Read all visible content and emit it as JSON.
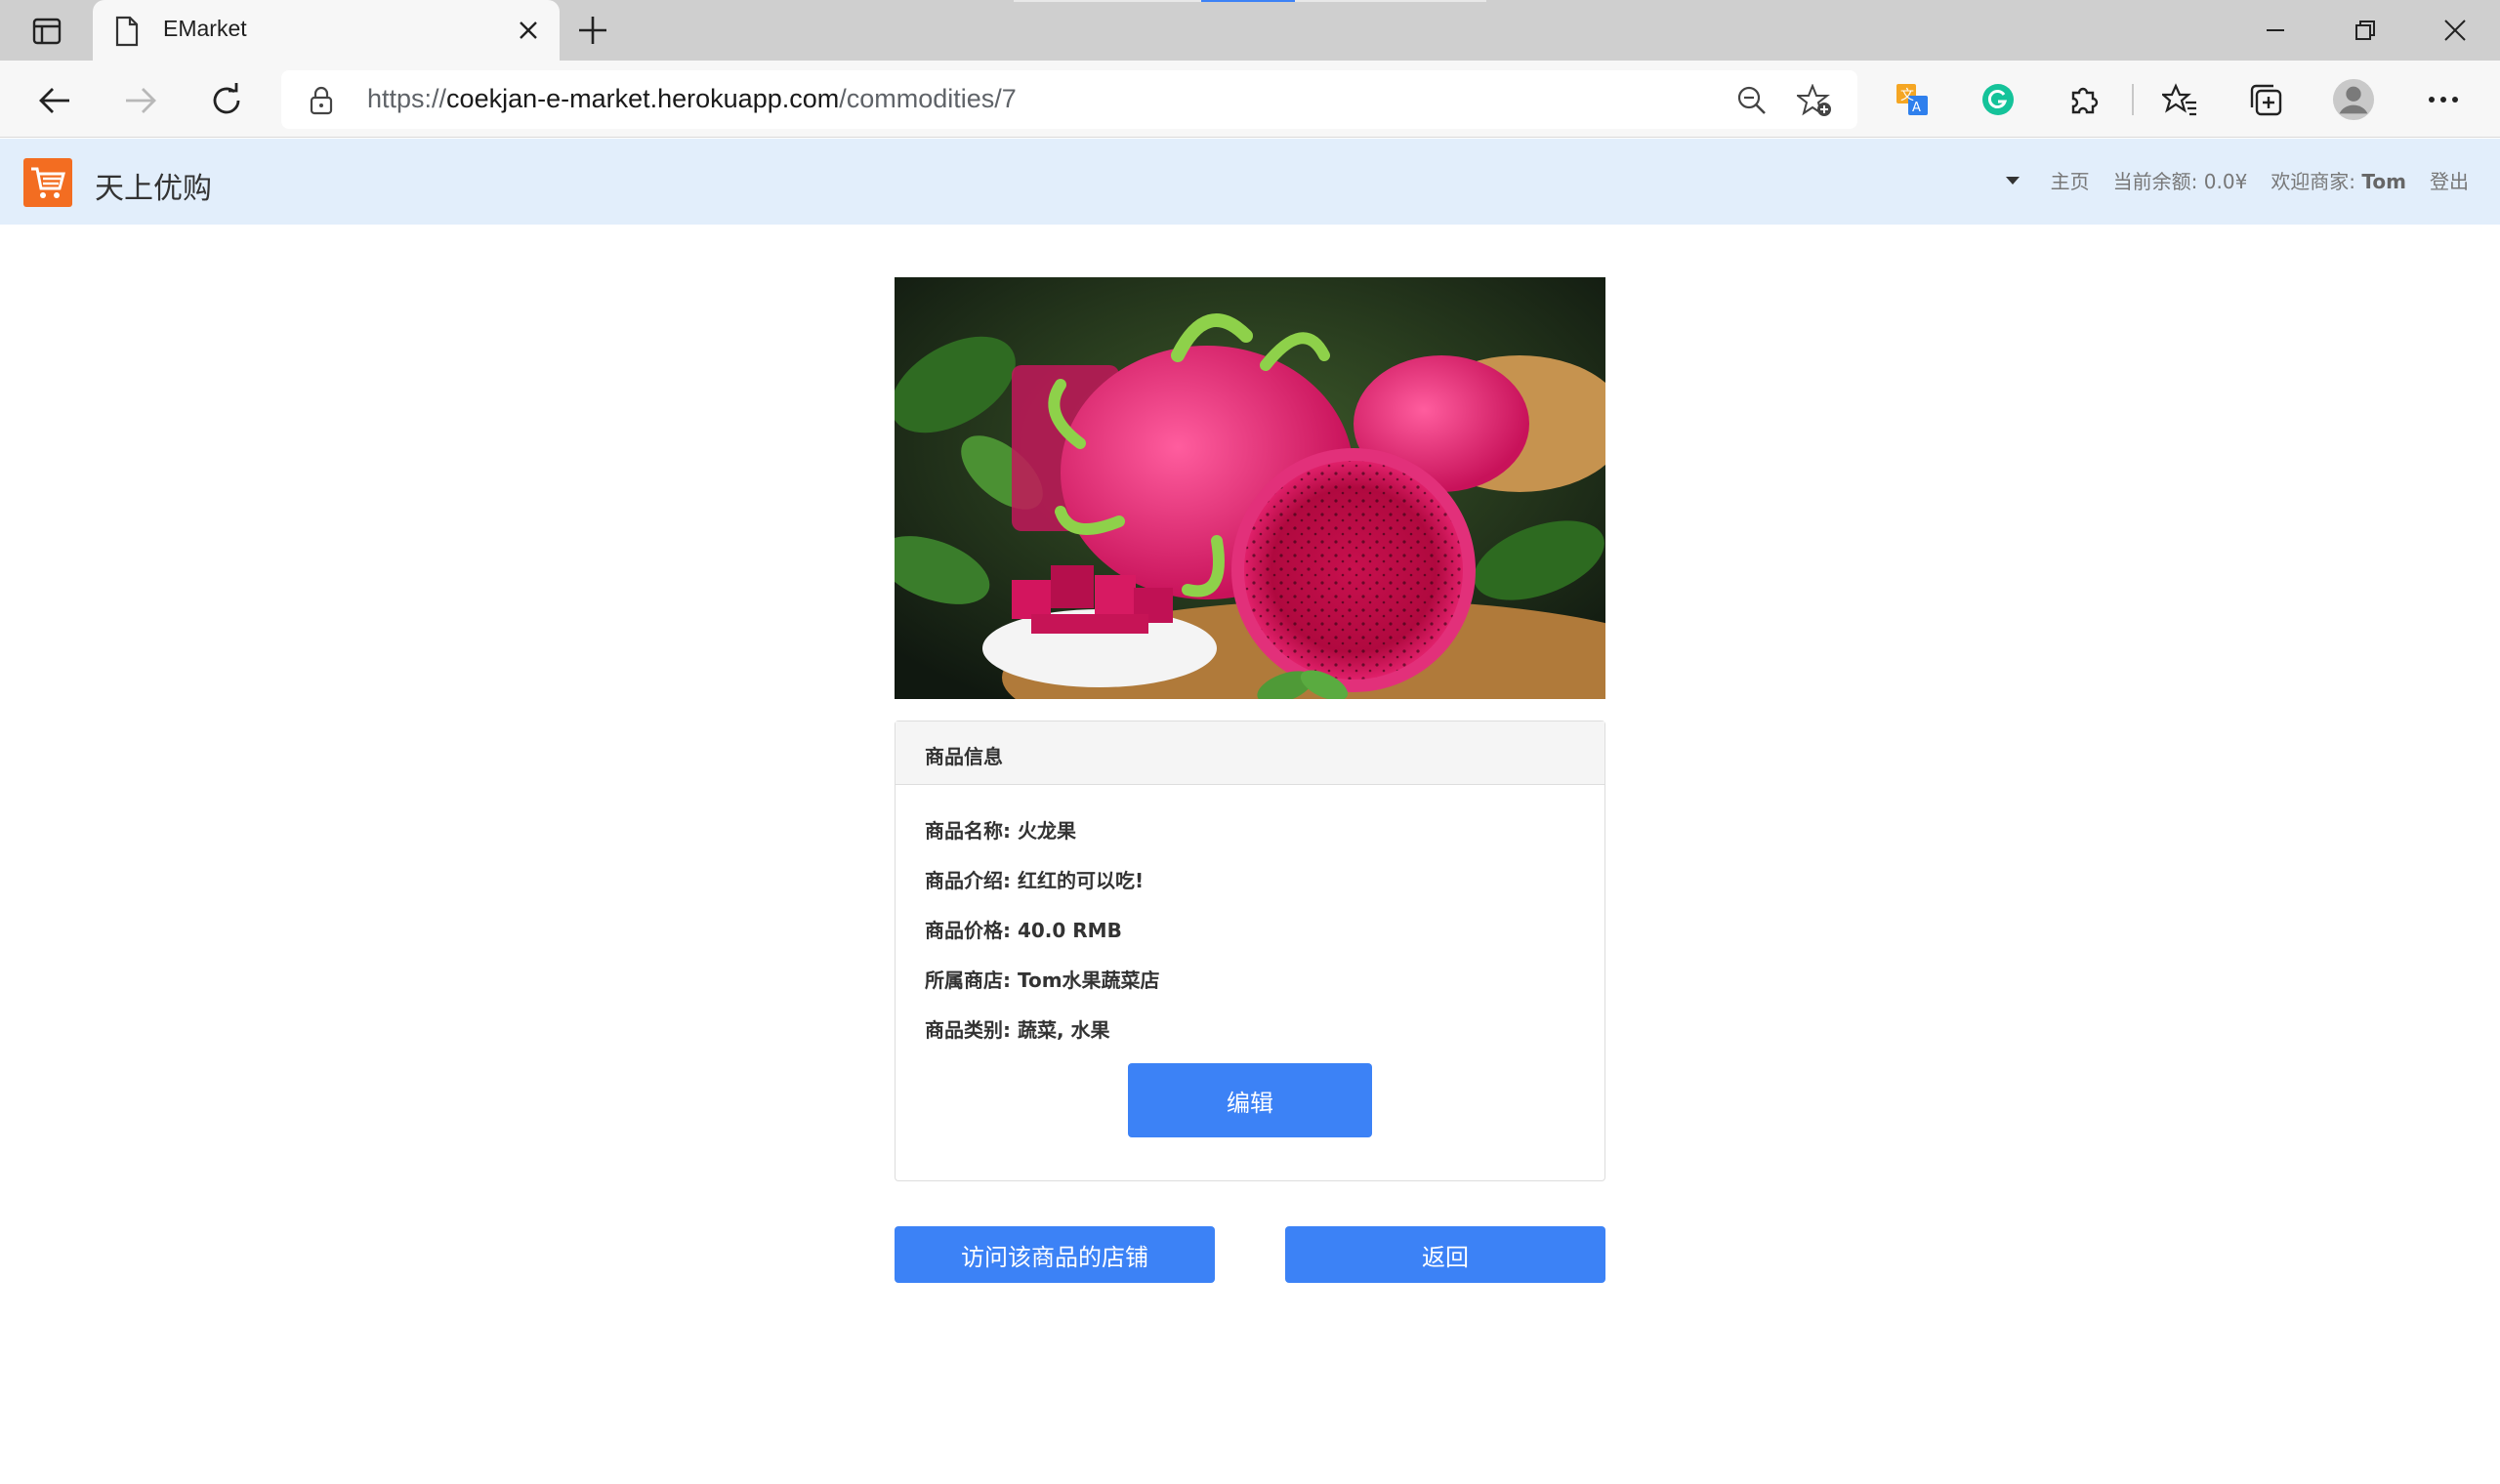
{
  "browser": {
    "tab_title": "EMarket",
    "url_prefix": "https://",
    "url_host": "coekjan-e-market.herokuapp.com",
    "url_path": "/commodities/7"
  },
  "navbar": {
    "brand": "天上优购",
    "home_link": "主页",
    "balance_label": "当前余额:",
    "balance_value": "0.0¥",
    "welcome_label": "欢迎商家:",
    "username": "Tom",
    "logout_link": "登出"
  },
  "product": {
    "image_alt": "火龙果",
    "card_title": "商品信息",
    "fields": [
      {
        "label": "商品名称:",
        "value": "火龙果"
      },
      {
        "label": "商品介绍:",
        "value": "红红的可以吃!"
      },
      {
        "label": "商品价格:",
        "value": "40.0 RMB"
      },
      {
        "label": "所属商店:",
        "value": "Tom水果蔬菜店"
      },
      {
        "label": "商品类别:",
        "value": "蔬菜, 水果"
      }
    ],
    "edit_button": "编辑"
  },
  "actions": {
    "visit_shop": "访问该商品的店铺",
    "back": "返回"
  },
  "colors": {
    "navbar_bg": "#e2eefb",
    "brand_orange": "#f36d21",
    "primary_button": "#3c82f6"
  }
}
